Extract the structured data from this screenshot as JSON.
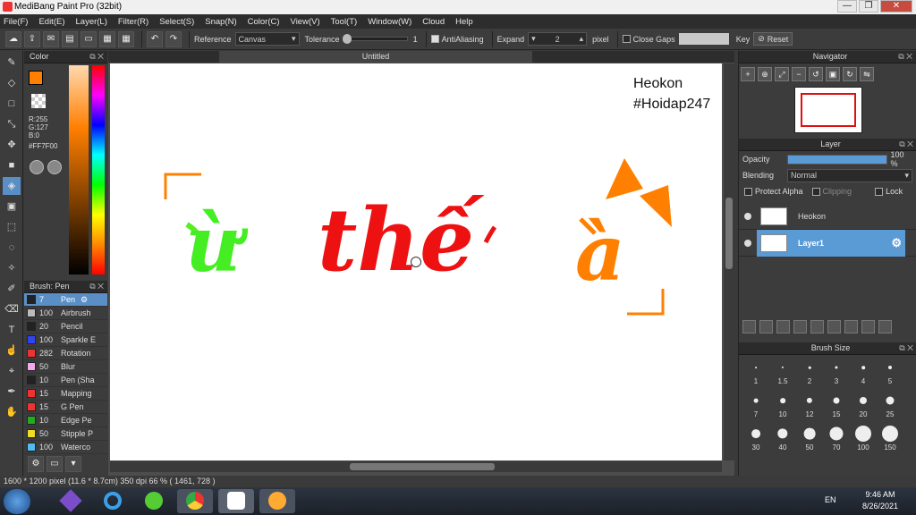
{
  "window": {
    "title": "MediBang Paint Pro (32bit)",
    "minimize": "—",
    "maximize": "❐",
    "close": "✕"
  },
  "menu": [
    "File(F)",
    "Edit(E)",
    "Layer(L)",
    "Filter(R)",
    "Select(S)",
    "Snap(N)",
    "Color(C)",
    "View(V)",
    "Tool(T)",
    "Window(W)",
    "Cloud",
    "Help"
  ],
  "toolbar": {
    "reference_label": "Reference",
    "reference_value": "Canvas",
    "tolerance_label": "Tolerance",
    "tolerance_value": "1",
    "antialias_label": "AntiAliasing",
    "expand_label": "Expand",
    "expand_value": "2",
    "expand_unit": "pixel",
    "closegaps_label": "Close Gaps",
    "key_label": "Key",
    "reset_label": "Reset"
  },
  "color_panel": {
    "title": "Color",
    "r": "R:255",
    "g": "G:127",
    "b": "B:0",
    "hex": "#FF7F00",
    "current_color": "#ff7f00"
  },
  "brush_panel": {
    "title": "Brush: Pen",
    "items": [
      {
        "size": "7",
        "name": "Pen",
        "color": "#222222",
        "selected": true
      },
      {
        "size": "100",
        "name": "Airbrush",
        "color": "#bbbbbb"
      },
      {
        "size": "20",
        "name": "Pencil",
        "color": "#222222"
      },
      {
        "size": "100",
        "name": "Sparkle E",
        "color": "#3344ee"
      },
      {
        "size": "282",
        "name": "Rotation",
        "color": "#ee3333"
      },
      {
        "size": "50",
        "name": "Blur",
        "color": "#f3a8f0"
      },
      {
        "size": "10",
        "name": "Pen (Sha",
        "color": "#222222"
      },
      {
        "size": "15",
        "name": "Mapping",
        "color": "#ee3333"
      },
      {
        "size": "15",
        "name": "G Pen",
        "color": "#ee3333"
      },
      {
        "size": "10",
        "name": "Edge Pe",
        "color": "#22aa22"
      },
      {
        "size": "50",
        "name": "Stipple P",
        "color": "#eedd22"
      },
      {
        "size": "100",
        "name": "Waterco",
        "color": "#55bbee"
      }
    ]
  },
  "canvas": {
    "tab_title": "Untitled",
    "watermark_line1": "Heokon",
    "watermark_line2": "#Hoidap247",
    "text_green": "ừ",
    "text_red": "thế",
    "text_orange": "à"
  },
  "navigator": {
    "title": "Navigator"
  },
  "layer_panel": {
    "title": "Layer",
    "opacity_label": "Opacity",
    "opacity_value": "100 %",
    "opacity_fraction": 1.0,
    "blending_label": "Blending",
    "blending_value": "Normal",
    "protect_alpha": "Protect Alpha",
    "clipping": "Clipping",
    "lock": "Lock",
    "layers": [
      {
        "name": "Heokon",
        "selected": false
      },
      {
        "name": "Layer1",
        "selected": true
      }
    ]
  },
  "brush_size": {
    "title": "Brush Size",
    "sizes": [
      "1",
      "1.5",
      "2",
      "3",
      "4",
      "5",
      "7",
      "10",
      "12",
      "15",
      "20",
      "25",
      "30",
      "40",
      "50",
      "70",
      "100",
      "150"
    ]
  },
  "statusbar": {
    "text": "1600 * 1200 pixel   (11.6 * 8.7cm)   350 dpi   66 %   ( 1461, 728 )"
  },
  "taskbar": {
    "lang": "EN",
    "time": "9:46 AM",
    "date": "8/26/2021"
  }
}
